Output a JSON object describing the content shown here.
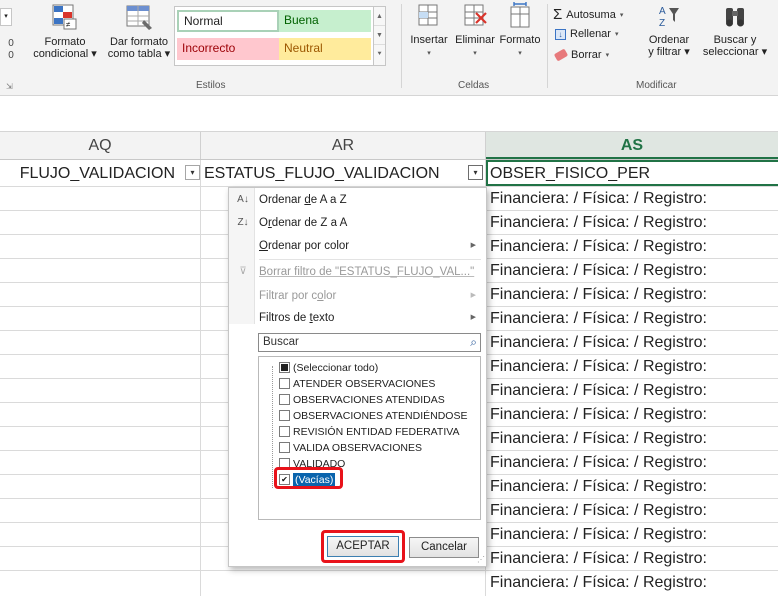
{
  "ribbon": {
    "conditional_format": {
      "line1": "Formato",
      "line2": "condicional ▾"
    },
    "format_as_table": {
      "line1": "Dar formato",
      "line2": "como tabla ▾"
    },
    "styles": {
      "normal": "Normal",
      "good": "Buena",
      "bad": "Incorrecto",
      "neutral": "Neutral"
    },
    "styles_group_label": "Estilos",
    "insert": "Insertar",
    "delete": "Eliminar",
    "format": "Formato",
    "cells_group_label": "Celdas",
    "autosum": "Autosuma",
    "fill": "Rellenar",
    "clear": "Borrar",
    "sort_filter": {
      "line1": "Ordenar",
      "line2": "y filtrar ▾"
    },
    "find_select": {
      "line1": "Buscar y",
      "line2": "seleccionar ▾"
    },
    "editing_group_label": "Modificar",
    "left_cut_text": "0\n0",
    "icons": [
      "conditional-format-icon",
      "format-table-icon",
      "insert-cells-icon",
      "delete-cells-icon",
      "format-cells-icon",
      "autosum-icon",
      "fill-icon",
      "eraser-icon",
      "sort-filter-icon",
      "binoculars-icon"
    ]
  },
  "columns": {
    "aq": "AQ",
    "ar": "AR",
    "as": "AS"
  },
  "header_row": {
    "aq": "FLUJO_VALIDACION",
    "ar": "ESTATUS_FLUJO_VALIDACION",
    "as": "OBSER_FISICO_PER"
  },
  "rows": [
    "Financiera:  / Física:  / Registro:",
    "Financiera:  / Física:  / Registro:",
    "Financiera:  / Física:  / Registro:",
    "Financiera:  / Física:  / Registro:",
    "Financiera:  / Física:  / Registro:",
    "Financiera:  / Física:  / Registro:",
    "Financiera:  / Física:  / Registro:",
    "Financiera:  / Física:  / Registro:",
    "Financiera:  / Física:  / Registro:",
    "Financiera:  / Física:  / Registro:",
    "Financiera:  / Física:  / Registro:",
    "Financiera:  / Física:  / Registro:",
    "Financiera:  / Física:  / Registro:",
    "Financiera:  / Física:  / Registro:",
    "Financiera:  / Física:  / Registro:",
    "Financiera:  / Física:  / Registro:"
  ],
  "filter_menu": {
    "sort_asc": {
      "pre": "Ordenar ",
      "key": "d",
      "post": "e A a Z"
    },
    "sort_desc": {
      "pre": "O",
      "key": "r",
      "post": "denar de Z a A"
    },
    "sort_color": {
      "pre": "",
      "key": "O",
      "post": "rdenar por color"
    },
    "clear_filter": "Borrar filtro de \"ESTATUS_FLUJO_VAL...\"",
    "filter_color": {
      "pre": "Filtrar por c",
      "key": "o",
      "post": "lor"
    },
    "text_filters": {
      "pre": "Filtros de ",
      "key": "t",
      "post": "exto"
    },
    "search_placeholder": "Buscar",
    "options": {
      "select_all": "(Seleccionar todo)",
      "opt1": "ATENDER OBSERVACIONES",
      "opt2": "OBSERVACIONES ATENDIDAS",
      "opt3": "OBSERVACIONES ATENDIÉNDOSE",
      "opt4": "REVISIÓN ENTIDAD FEDERATIVA",
      "opt5": "VALIDA OBSERVACIONES",
      "opt6": "VALIDADO",
      "opt7": "(Vacías)"
    },
    "checked": {
      "select_all": "partial",
      "opt7": "checked"
    },
    "ok": "ACEPTAR",
    "cancel": "Cancelar"
  },
  "colors": {
    "excel_green": "#217346",
    "highlight_red": "#e8121a",
    "good_fill": "#c6efce",
    "bad_fill": "#ffc7ce",
    "neutral_fill": "#ffeb9c"
  }
}
